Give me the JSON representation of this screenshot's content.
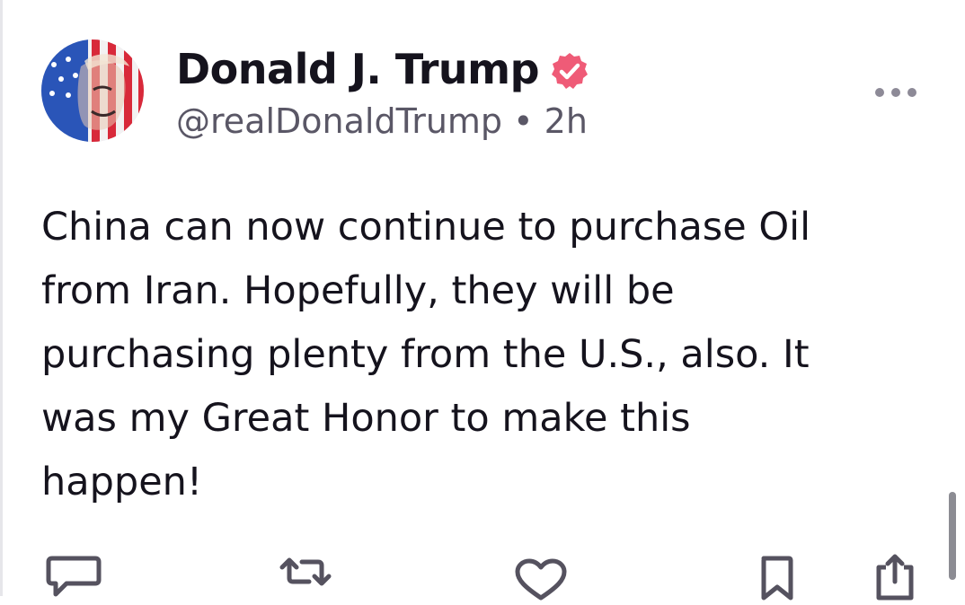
{
  "post": {
    "display_name": "Donald J. Trump",
    "handle": "@realDonaldTrump",
    "separator": "•",
    "time": "2h",
    "body_lines": [
      "China can now continue to purchase Oil",
      "from Iran. Hopefully, they will be",
      "purchasing plenty from the U.S., also. It",
      "was my Great Honor to make this",
      "happen!"
    ],
    "verified": true,
    "accent_color": "#ef5b77"
  },
  "actions": [
    {
      "icon": "reply-icon"
    },
    {
      "icon": "repost-icon"
    },
    {
      "icon": "like-icon"
    },
    {
      "icon": "bookmark-icon"
    },
    {
      "icon": "share-icon"
    }
  ]
}
